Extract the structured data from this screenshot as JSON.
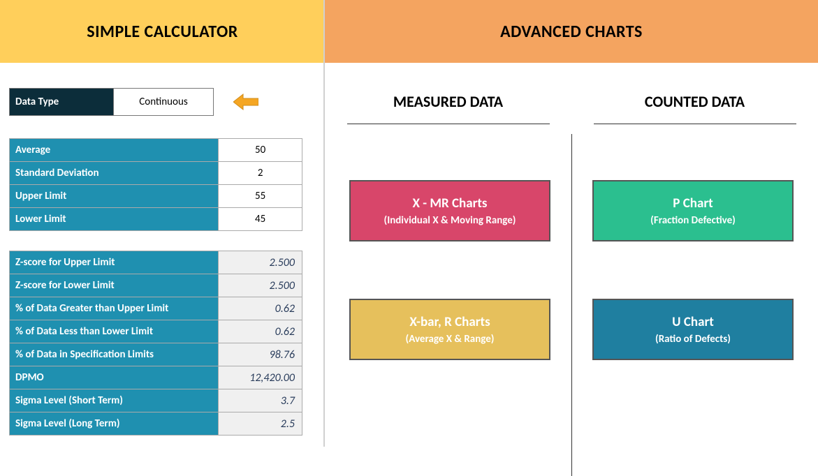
{
  "left": {
    "header": "SIMPLE CALCULATOR",
    "datatype_label": "Data Type",
    "datatype_value": "Continuous",
    "inputs": {
      "average_label": "Average",
      "average_value": "50",
      "stddev_label": "Standard Deviation",
      "stddev_value": "2",
      "upper_label": "Upper Limit",
      "upper_value": "55",
      "lower_label": "Lower Limit",
      "lower_value": "45"
    },
    "calcs": {
      "zupper_label": "Z-score for Upper Limit",
      "zupper_value": "2.500",
      "zlower_label": "Z-score for Lower Limit",
      "zlower_value": "2.500",
      "pgreater_label": "% of Data Greater than Upper Limit",
      "pgreater_value": "0.62",
      "pless_label": "% of Data Less than Lower Limit",
      "pless_value": "0.62",
      "pinspec_label": "% of Data in Specification Limits",
      "pinspec_value": "98.76",
      "dpmo_label": "DPMO",
      "dpmo_value": "12,420.00",
      "sigmashort_label": "Sigma Level (Short Term)",
      "sigmashort_value": "3.7",
      "sigmalong_label": "Sigma Level (Long Term)",
      "sigmalong_value": "2.5"
    }
  },
  "right": {
    "header": "ADVANCED CHARTS",
    "measured_title": "MEASURED DATA",
    "counted_title": "COUNTED DATA",
    "xmr_title": "X - MR Charts",
    "xmr_sub": "(Individual X & Moving Range)",
    "p_title": "P Chart",
    "p_sub": "(Fraction Defective)",
    "xbar_title": "X-bar, R Charts",
    "xbar_sub": "(Average X & Range)",
    "u_title": "U Chart",
    "u_sub": "(Ratio of Defects)"
  }
}
